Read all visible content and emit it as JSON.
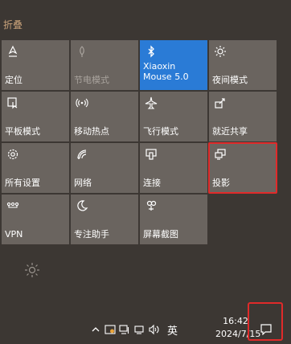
{
  "header": {
    "collapse_label": "折叠"
  },
  "tiles": [
    {
      "label": "定位",
      "icon": "location-icon",
      "state": "normal"
    },
    {
      "label": "节电模式",
      "icon": "battery-saver-icon",
      "state": "dim"
    },
    {
      "label": "Xiaoxin Mouse 5.0",
      "icon": "bluetooth-icon",
      "state": "active"
    },
    {
      "label": "夜间模式",
      "icon": "night-light-icon",
      "state": "normal"
    },
    {
      "label": "平板模式",
      "icon": "tablet-mode-icon",
      "state": "normal"
    },
    {
      "label": "移动热点",
      "icon": "mobile-hotspot-icon",
      "state": "normal"
    },
    {
      "label": "飞行模式",
      "icon": "airplane-icon",
      "state": "normal"
    },
    {
      "label": "就近共享",
      "icon": "nearby-share-icon",
      "state": "normal"
    },
    {
      "label": "所有设置",
      "icon": "settings-gear-icon",
      "state": "normal"
    },
    {
      "label": "网络",
      "icon": "network-icon",
      "state": "normal"
    },
    {
      "label": "连接",
      "icon": "connect-icon",
      "state": "normal"
    },
    {
      "label": "投影",
      "icon": "project-icon",
      "state": "highlighted"
    },
    {
      "label": "VPN",
      "icon": "vpn-icon",
      "state": "normal"
    },
    {
      "label": "专注助手",
      "icon": "focus-assist-moon-icon",
      "state": "normal"
    },
    {
      "label": "屏幕截图",
      "icon": "screen-snip-icon",
      "state": "normal"
    }
  ],
  "brightness": {
    "icon": "brightness-sun-icon"
  },
  "taskbar": {
    "tray_icons": [
      "chevron-up-icon",
      "security-icon",
      "network-tray-icon",
      "display-tray-icon",
      "volume-icon"
    ],
    "ime_label": "英",
    "time": "16:42",
    "date": "2024/7/15",
    "notification_icon": "action-center-icon"
  },
  "colors": {
    "tile_bg": "#6a645f",
    "active_tile_bg": "#2a7bd6",
    "highlight": "#e02a2a",
    "accent_text": "#c9a27a"
  }
}
